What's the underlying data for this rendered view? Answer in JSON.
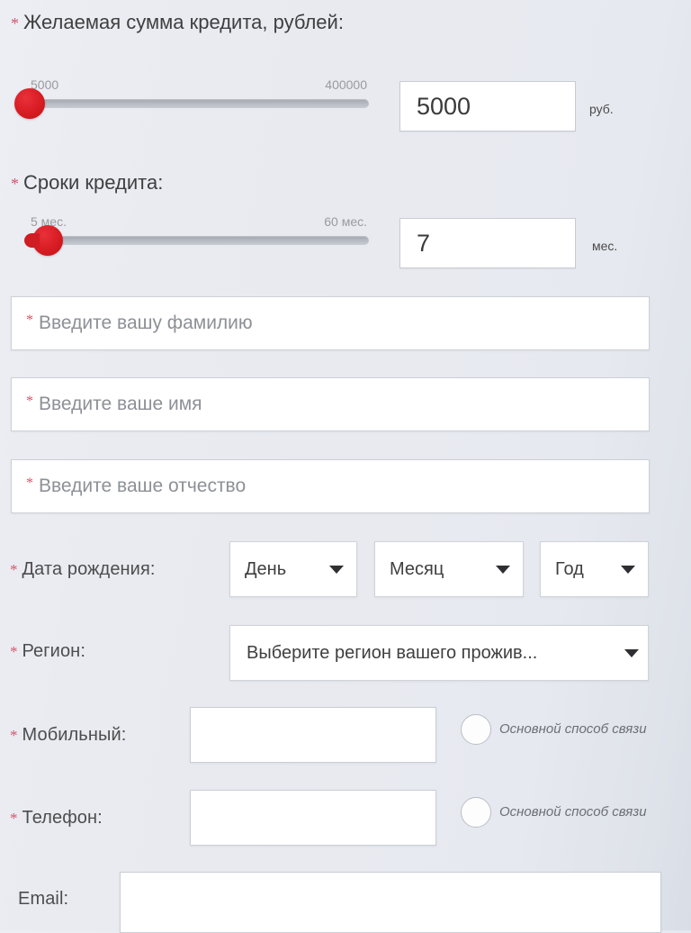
{
  "form": {
    "required_marker": "*",
    "accent_color": "#d2566a",
    "slider_color": "#d01c23",
    "amount_section": {
      "heading": "Желаемая сумма кредита, рублей:",
      "slider": {
        "min_label": "5000",
        "max_label": "400000",
        "min": 5000,
        "max": 400000,
        "value": 5000,
        "handle_percent": 0
      },
      "input_value": "5000",
      "unit": "руб."
    },
    "term_section": {
      "heading": "Сроки кредита:",
      "slider": {
        "min_label": "5 мес.",
        "max_label": "60 мес.",
        "min": 5,
        "max": 60,
        "value": 7,
        "handle_percent": 4
      },
      "input_value": "7",
      "unit": "мес."
    },
    "name_fields": [
      {
        "name": "lastname",
        "placeholder": "Введите вашу фамилию",
        "value": "",
        "required": true
      },
      {
        "name": "firstname",
        "placeholder": "Введите ваше имя",
        "value": "",
        "required": true
      },
      {
        "name": "patronymic",
        "placeholder": "Введите ваше отчество",
        "value": "",
        "required": true
      }
    ],
    "birthdate": {
      "label": "Дата рождения:",
      "day": {
        "selected": "День"
      },
      "month": {
        "selected": "Месяц"
      },
      "year": {
        "selected": "Год"
      }
    },
    "region": {
      "label": "Регион:",
      "selected": "Выберите регион вашего прожив..."
    },
    "mobile": {
      "label": "Мобильный:",
      "value": "",
      "radio_label": "Основной способ связи"
    },
    "phone": {
      "label": "Телефон:",
      "value": "",
      "radio_label": "Основной способ связи"
    },
    "email": {
      "label": "Email:",
      "value": ""
    }
  }
}
